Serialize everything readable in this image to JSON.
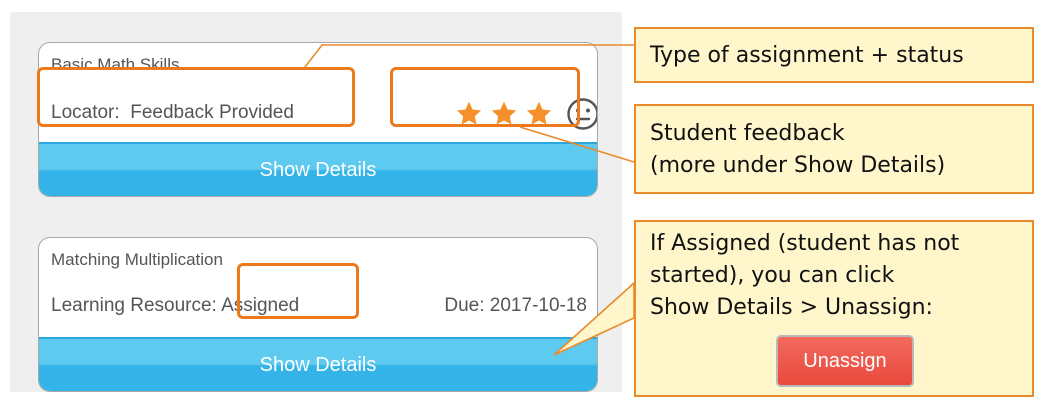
{
  "cards": [
    {
      "title": "Basic Math Skills",
      "type_label": "Locator:",
      "status": "Feedback Provided",
      "stars": 3,
      "feedback_face": "neutral-face-icon",
      "details_label": "Show Details"
    },
    {
      "title": "Matching Multiplication",
      "type_label": "Learning Resource:",
      "status": "Assigned",
      "due": "Due: 2017-10-18",
      "details_label": "Show Details"
    }
  ],
  "callouts": {
    "type_status": "Type of assignment + status",
    "feedback": [
      "Student feedback",
      "(more under Show Details)"
    ],
    "assigned": [
      "If Assigned (student has not",
      "started), you can click",
      "Show Details > Unassign:"
    ],
    "unassign_label": "Unassign"
  },
  "colors": {
    "highlight": "#ec7a1c",
    "callout_bg": "#fff6cc",
    "button_blue": "#33b3e8",
    "star": "#f5902a",
    "unassign_red": "#e9493c"
  }
}
